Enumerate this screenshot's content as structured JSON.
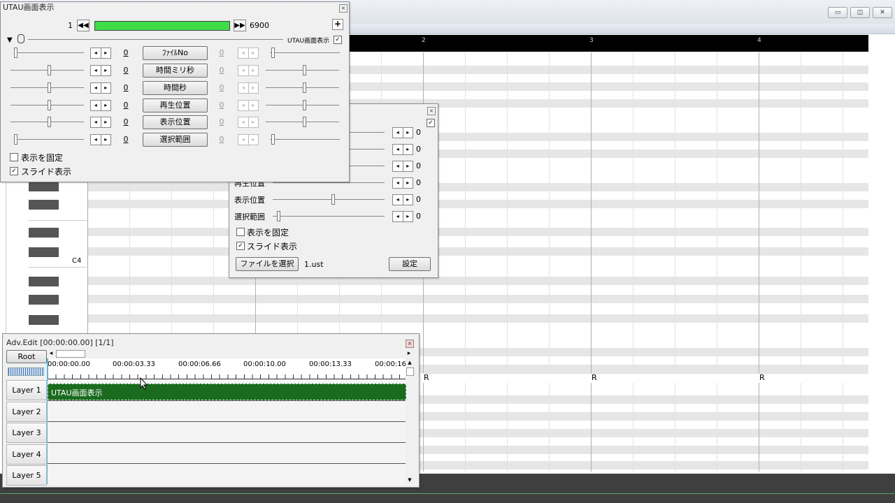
{
  "bg_window": {
    "controls": {
      "minimize": "▭",
      "restore": "◫",
      "close": "✕"
    },
    "ruler_marks": [
      "2",
      "3",
      "4"
    ],
    "piano": {
      "c4_label": "C4"
    },
    "rest_marks": [
      "R",
      "R",
      "R"
    ]
  },
  "utau_panel": {
    "title": "UTAU画面表示",
    "close": "×",
    "frame_start": "1",
    "frame_end": "6900",
    "add_btn": "+",
    "header_toggle_label": "UTAU画面表示",
    "header_toggle_checked": "✓",
    "rows": [
      {
        "button": "ﾌｧｲﾙNo",
        "left_value": "0",
        "right_value": "0"
      },
      {
        "button": "時間ミリ秒",
        "left_value": "0",
        "right_value": "0"
      },
      {
        "button": "時間秒",
        "left_value": "0",
        "right_value": "0"
      },
      {
        "button": "再生位置",
        "left_value": "0",
        "right_value": "0"
      },
      {
        "button": "表示位置",
        "left_value": "0",
        "right_value": "0"
      },
      {
        "button": "選択範囲",
        "left_value": "0",
        "right_value": "0"
      }
    ],
    "checkboxes": [
      {
        "label": "表示を固定",
        "mark": ""
      },
      {
        "label": "スライド表示",
        "mark": "✓"
      }
    ]
  },
  "mid_panel": {
    "close": "×",
    "corner_check": "✓",
    "partial_label": "再生位置",
    "rows": [
      {
        "label": "",
        "value": "0"
      },
      {
        "label": "",
        "value": "0"
      },
      {
        "label": "",
        "value": "0"
      },
      {
        "label": "",
        "value": "0"
      },
      {
        "label": "表示位置",
        "value": "0"
      },
      {
        "label": "選択範囲",
        "value": "0"
      }
    ],
    "checkboxes": [
      {
        "label": "表示を固定",
        "mark": ""
      },
      {
        "label": "スライド表示",
        "mark": "✓"
      }
    ],
    "file_button": "ファイルを選択",
    "file_name": "1.ust",
    "settings_button": "設定"
  },
  "adv_edit": {
    "title": "Adv.Edit [00:00:00.00] [1/1]",
    "close": "×",
    "root_button": "Root",
    "time_labels": [
      "00:00:00.00",
      "00:00:03.33",
      "00:00:06.66",
      "00:00:10.00",
      "00:00:13.33",
      "00:00:16"
    ],
    "layers": [
      "Layer 1",
      "Layer 2",
      "Layer 3",
      "Layer 4",
      "Layer 5"
    ],
    "clip_label": "UTAU画面表示",
    "clip_color": "#1a6b1f",
    "scroll_up": "▲",
    "scroll_down": "▼",
    "scroll_left": "◂",
    "scroll_right": "▸"
  }
}
